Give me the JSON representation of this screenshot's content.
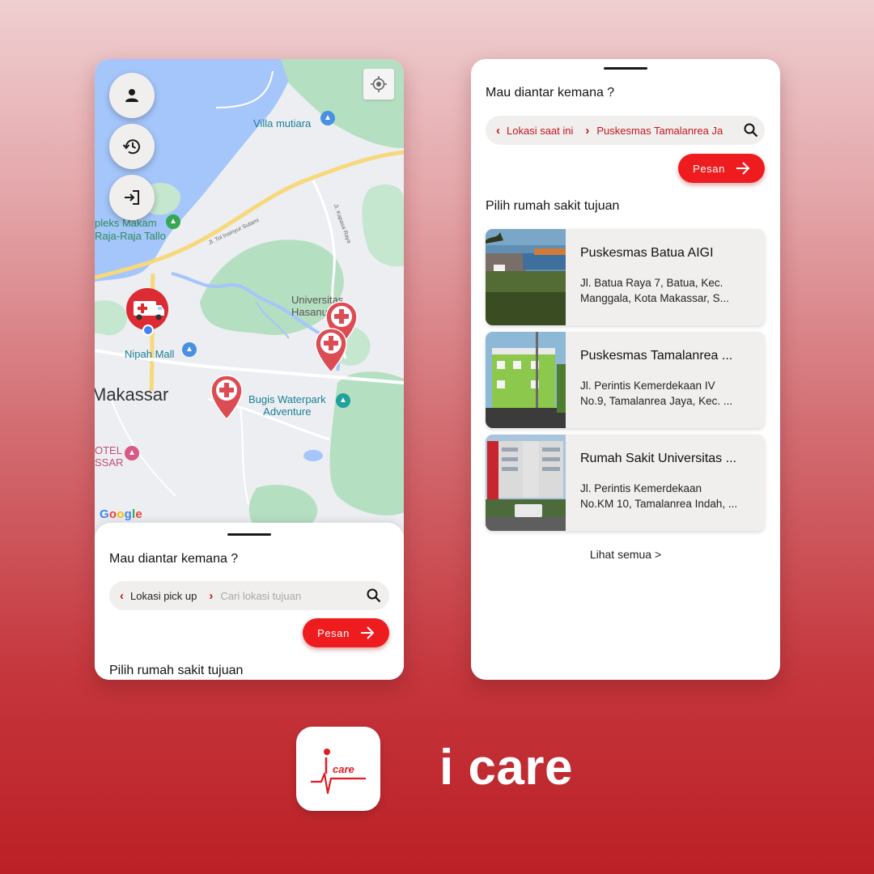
{
  "left_screen": {
    "map": {
      "labels": {
        "villa_mutiara": "Villa mutiara",
        "makam": "pleks Makam\nRaja-Raja Tallo",
        "makam_line1": "pleks Makam",
        "makam_line2": "Raja-Raja Tallo",
        "universitas_line1": "Universitas",
        "universitas_line2": "Hasanu",
        "nipah_mall": "Nipah Mall",
        "makassar": "Makassar",
        "bugis_line1": "Bugis Waterpark",
        "bugis_line2": "Adventure",
        "hotel_line1": "OTEL",
        "hotel_line2": "SSAR",
        "road_tol": "Jl. Tol Insinyur Sutami",
        "road_kapasa": "Jl. Kapasa Raya"
      },
      "google_logo": [
        "G",
        "o",
        "o",
        "g",
        "l",
        "e"
      ]
    },
    "fab_icons": [
      "person-icon",
      "history-icon",
      "login-icon"
    ],
    "sheet": {
      "title": "Mau diantar kemana ?",
      "pickup_label": "Lokasi pick up",
      "destination_placeholder": "Cari lokasi tujuan",
      "order_button": "Pesan",
      "section_title": "Pilih rumah sakit tujuan"
    }
  },
  "right_screen": {
    "title": "Mau diantar kemana ?",
    "pickup_value": "Lokasi saat ini",
    "destination_value": "Puskesmas Tamalanrea Ja",
    "order_button": "Pesan",
    "section_title": "Pilih rumah sakit tujuan",
    "hospitals": [
      {
        "name": "Puskesmas Batua AIGI",
        "address_line1": "Jl. Batua Raya 7, Batua, Kec.",
        "address_line2": "Manggala, Kota Makassar, S..."
      },
      {
        "name": "Puskesmas Tamalanrea ...",
        "address_line1": "Jl. Perintis Kemerdekaan IV",
        "address_line2": "No.9, Tamalanrea Jaya, Kec. ..."
      },
      {
        "name": "Rumah Sakit Universitas ...",
        "address_line1": "Jl. Perintis Kemerdekaan",
        "address_line2": "No.KM 10, Tamalanrea Indah, ..."
      }
    ],
    "see_all": "Lihat semua >"
  },
  "brand": {
    "icon_text": "care",
    "app_name": "i care"
  },
  "colors": {
    "primary_red": "#ee1c1f",
    "dark_red": "#c4151c",
    "sheet_gray": "#f1efee",
    "map_water": "#a5c6fb",
    "map_green": "#b5dfc1",
    "map_land": "#eceef2"
  }
}
